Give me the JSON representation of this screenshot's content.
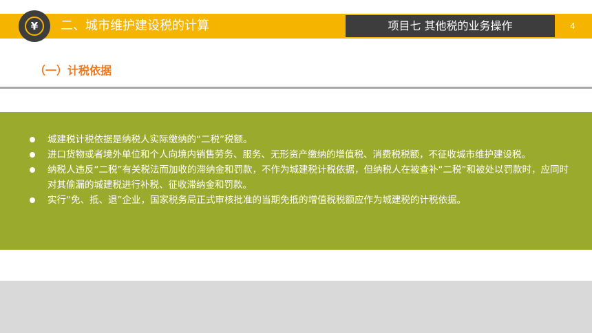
{
  "header": {
    "logo_symbol": "¥",
    "title": "二、城市维护建设税的计算",
    "project_label": "项目七   其他税的业务操作",
    "page_number": "4"
  },
  "section": {
    "title": "（一）计税依据"
  },
  "content": {
    "bullets": [
      "城建税计税依据是纳税人实际缴纳的“二税”税额。",
      "进口货物或者境外单位和个人向境内销售劳务、服务、无形资产缴纳的增值税、消费税税额，不征收城市维护建设税。",
      " 纳税人违反“二税”有关税法而加收的滞纳金和罚款，不作为城建税计税依据，但纳税人在被查补“二税”和被处以罚款时，应同时对其偷漏的城建税进行补税、征收滞纳金和罚款。",
      "实行“免、抵、退”企业，国家税务局正式审核批准的当期免抵的增值税税额应作为城建税的计税依据。"
    ]
  },
  "colors": {
    "header_bar": "#f5b400",
    "dark_box": "#3d3d3d",
    "section_title": "#ee7a1f",
    "content_panel": "#9aaa2c",
    "footer_band": "#d9d9d9"
  }
}
